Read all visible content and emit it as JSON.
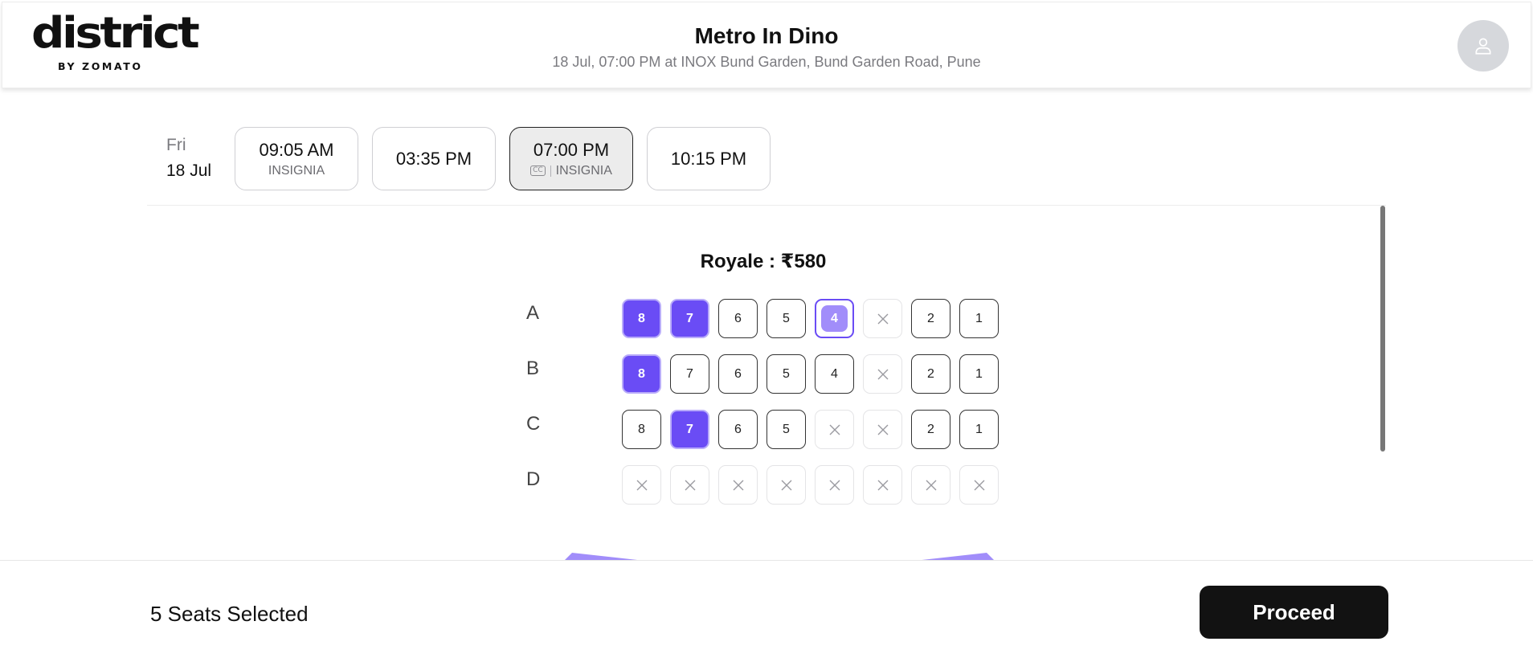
{
  "brand": {
    "name": "district",
    "sub": "BY ZOMATO"
  },
  "header": {
    "title": "Metro In Dino",
    "subtitle": "18 Jul, 07:00 PM at INOX Bund Garden, Bund Garden Road, Pune"
  },
  "showtimes": {
    "date_label": "Fri",
    "date_day": "18 Jul",
    "times": [
      {
        "time": "09:05 AM",
        "format": "INSIGNIA",
        "cc": false,
        "selected": false
      },
      {
        "time": "03:35 PM",
        "format": "",
        "cc": false,
        "selected": false
      },
      {
        "time": "07:00 PM",
        "format": "INSIGNIA",
        "cc": true,
        "selected": true
      },
      {
        "time": "10:15 PM",
        "format": "",
        "cc": false,
        "selected": false
      }
    ]
  },
  "seating": {
    "section": "Royale : ₹580",
    "rows": [
      {
        "label": "A",
        "seats": [
          {
            "num": "8",
            "status": "selected"
          },
          {
            "num": "7",
            "status": "selected"
          },
          {
            "num": "6",
            "status": "available"
          },
          {
            "num": "5",
            "status": "available"
          },
          {
            "num": "4",
            "status": "selecting"
          },
          {
            "num": "",
            "status": "unavailable"
          },
          {
            "num": "2",
            "status": "available"
          },
          {
            "num": "1",
            "status": "available"
          }
        ]
      },
      {
        "label": "B",
        "seats": [
          {
            "num": "8",
            "status": "selected"
          },
          {
            "num": "7",
            "status": "available"
          },
          {
            "num": "6",
            "status": "available"
          },
          {
            "num": "5",
            "status": "available"
          },
          {
            "num": "4",
            "status": "available"
          },
          {
            "num": "",
            "status": "unavailable"
          },
          {
            "num": "2",
            "status": "available"
          },
          {
            "num": "1",
            "status": "available"
          }
        ]
      },
      {
        "label": "C",
        "seats": [
          {
            "num": "8",
            "status": "available"
          },
          {
            "num": "7",
            "status": "selected"
          },
          {
            "num": "6",
            "status": "available"
          },
          {
            "num": "5",
            "status": "available"
          },
          {
            "num": "",
            "status": "unavailable"
          },
          {
            "num": "",
            "status": "unavailable"
          },
          {
            "num": "2",
            "status": "available"
          },
          {
            "num": "1",
            "status": "available"
          }
        ]
      },
      {
        "label": "D",
        "seats": [
          {
            "num": "",
            "status": "unavailable"
          },
          {
            "num": "",
            "status": "unavailable"
          },
          {
            "num": "",
            "status": "unavailable"
          },
          {
            "num": "",
            "status": "unavailable"
          },
          {
            "num": "",
            "status": "unavailable"
          },
          {
            "num": "",
            "status": "unavailable"
          },
          {
            "num": "",
            "status": "unavailable"
          },
          {
            "num": "",
            "status": "unavailable"
          }
        ]
      }
    ]
  },
  "footer": {
    "seats_selected": "5 Seats Selected",
    "proceed_label": "Proceed"
  },
  "icons": {
    "avatar": "user-icon",
    "unavailable": "close-icon",
    "subtitles": "cc-icon"
  },
  "colors": {
    "accent": "#6a4cf5",
    "accent_light": "#a18dfa",
    "button_dark": "#121212"
  }
}
